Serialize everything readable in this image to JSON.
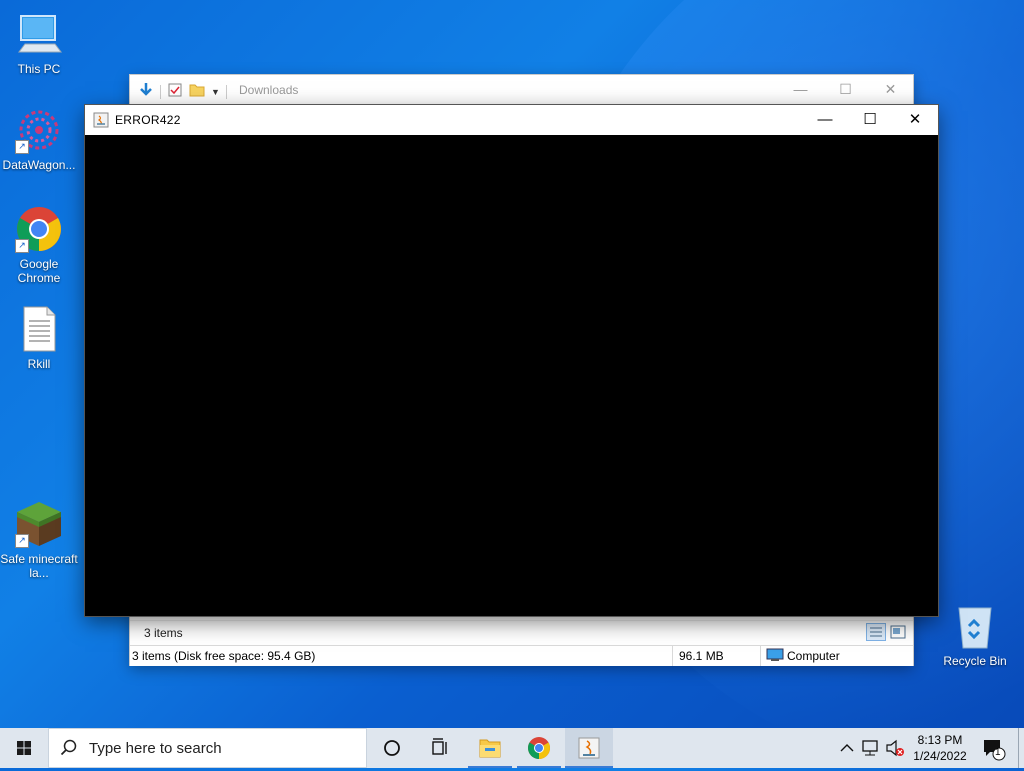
{
  "desktop": {
    "icons": [
      {
        "label": "This PC",
        "icon": "this-pc-icon"
      },
      {
        "label": "DataWagon...",
        "icon": "datawagon-icon"
      },
      {
        "label": "Google Chrome",
        "icon": "chrome-icon"
      },
      {
        "label": "Rkill",
        "icon": "text-file-icon"
      },
      {
        "label": "Safe minecraft la...",
        "icon": "minecraft-icon"
      },
      {
        "label": "Recycle Bin",
        "icon": "recycle-bin-icon"
      }
    ]
  },
  "explorer": {
    "title": "Downloads",
    "items_count": "3 items",
    "status_left": "3 items (Disk free space: 95.4 GB)",
    "status_size": "96.1 MB",
    "status_location": "Computer",
    "controls": {
      "minimize": "—",
      "maximize": "☐",
      "close": "✕"
    }
  },
  "java_window": {
    "title": "ERROR422",
    "controls": {
      "minimize": "—",
      "maximize": "☐",
      "close": "✕"
    },
    "background": "#000000"
  },
  "taskbar": {
    "search_placeholder": "Type here to search",
    "time": "8:13 PM",
    "date": "1/24/2022",
    "notifications_count": "1",
    "pinned": [
      "cortana-icon",
      "task-view-icon",
      "file-explorer-icon",
      "chrome-icon",
      "java-icon"
    ]
  },
  "colors": {
    "accent": "#3a7bd5",
    "desktop": "#0a6ad8",
    "taskbar": "#dfe6ee"
  }
}
